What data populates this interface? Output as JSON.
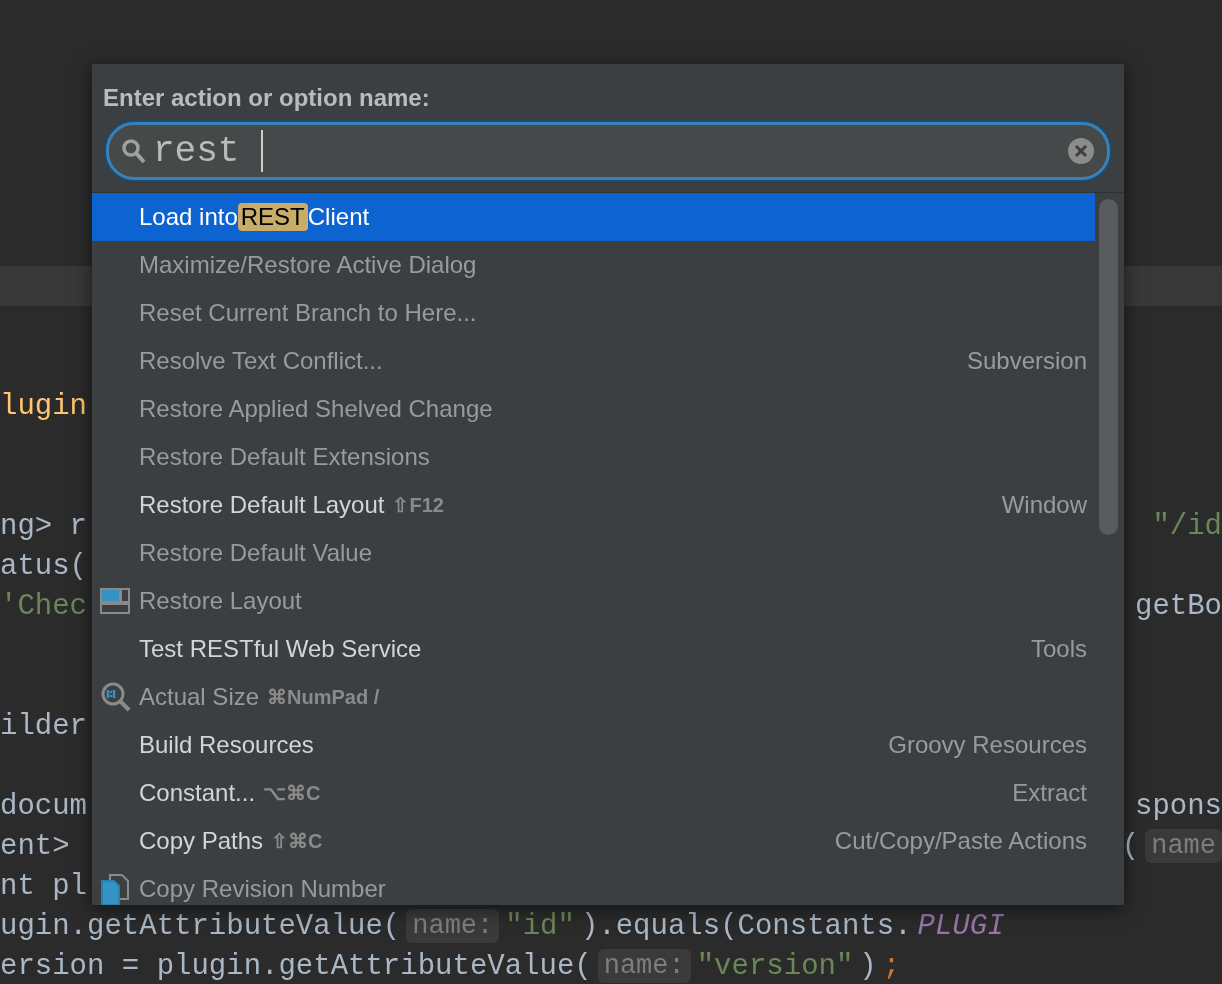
{
  "editor": {
    "lines": [
      {
        "current": false
      },
      {
        "current": false
      },
      {
        "current": false
      },
      {
        "current": true
      },
      {
        "current": false
      },
      {
        "current": false
      },
      {
        "current": false,
        "left": [
          {
            "kind": "method",
            "text": "lugin"
          }
        ]
      },
      {
        "current": false
      },
      {
        "current": false
      },
      {
        "current": false,
        "left": [
          {
            "kind": "plain",
            "text": "ng> r"
          }
        ],
        "right": [
          {
            "kind": "string",
            "text": "\"/id"
          }
        ]
      },
      {
        "current": false,
        "left": [
          {
            "kind": "plain",
            "text": "atus("
          }
        ]
      },
      {
        "current": false,
        "left": [
          {
            "kind": "string",
            "text": "'Chec"
          }
        ],
        "right": [
          {
            "kind": "plain",
            "text": "getBo"
          }
        ]
      },
      {
        "current": false
      },
      {
        "current": false
      },
      {
        "current": false,
        "left": [
          {
            "kind": "plain",
            "text": "ilder"
          }
        ]
      },
      {
        "current": false
      },
      {
        "current": false,
        "left": [
          {
            "kind": "plain",
            "text": "docum"
          }
        ],
        "right": [
          {
            "kind": "plain",
            "text": "spons"
          }
        ]
      },
      {
        "current": false,
        "left": [
          {
            "kind": "plain",
            "text": "ent>"
          }
        ],
        "right": [
          {
            "kind": "plain",
            "text": "("
          },
          {
            "kind": "hint",
            "text": "name"
          }
        ]
      },
      {
        "current": false,
        "left": [
          {
            "kind": "plain",
            "text": "nt pl"
          }
        ]
      },
      {
        "current": false,
        "left": [
          {
            "kind": "plain",
            "text": "ugin.getAttributeValue("
          },
          {
            "kind": "hint",
            "text": "name:"
          },
          {
            "kind": "string",
            "text": "\"id\""
          },
          {
            "kind": "plain",
            "text": ").equals(Constants."
          },
          {
            "kind": "constant",
            "text": "PLUGI"
          }
        ]
      },
      {
        "current": false,
        "left": [
          {
            "kind": "plain",
            "text": "ersion = plugin.getAttributeValue("
          },
          {
            "kind": "hint",
            "text": "name:"
          },
          {
            "kind": "string",
            "text": "\"version\""
          },
          {
            "kind": "plain",
            "text": ")"
          },
          {
            "kind": "keyword",
            "text": ";"
          }
        ]
      }
    ]
  },
  "popup": {
    "title": "Enter action or option name:",
    "search": {
      "value": "rest"
    },
    "items": [
      {
        "label": "Load into ",
        "match": "REST",
        "after": " Client",
        "selected": true,
        "disabled": false
      },
      {
        "label": "Maximize/Restore Active Dialog",
        "selected": false,
        "disabled": true
      },
      {
        "label": "Reset Current Branch to Here...",
        "selected": false,
        "disabled": true
      },
      {
        "label": "Resolve Text Conflict...",
        "group": "Subversion",
        "selected": false,
        "disabled": true
      },
      {
        "label": "Restore Applied Shelved Change",
        "selected": false,
        "disabled": true
      },
      {
        "label": "Restore Default Extensions",
        "selected": false,
        "disabled": true
      },
      {
        "label": "Restore Default Layout",
        "shortcut": "⇧F12",
        "group": "Window",
        "selected": false,
        "disabled": false
      },
      {
        "label": "Restore Default Value",
        "selected": false,
        "disabled": true
      },
      {
        "label": "Restore Layout",
        "kind": "layout",
        "selected": false,
        "disabled": true
      },
      {
        "label": "Test RESTful Web Service",
        "group": "Tools",
        "selected": false,
        "disabled": false
      },
      {
        "label": "Actual Size",
        "shortcut": "⌘NumPad /",
        "kind": "zoom",
        "selected": false,
        "disabled": true
      },
      {
        "label": "Build Resources",
        "group": "Groovy Resources",
        "selected": false,
        "disabled": false
      },
      {
        "label": "Constant...",
        "shortcut": "⌥⌘C",
        "group": "Extract",
        "selected": false,
        "disabled": false
      },
      {
        "label": "Copy Paths",
        "shortcut": "⇧⌘C",
        "group": "Cut/Copy/Paste Actions",
        "selected": false,
        "disabled": false
      },
      {
        "label": "Copy Revision Number",
        "kind": "copy",
        "selected": false,
        "disabled": true
      }
    ]
  }
}
